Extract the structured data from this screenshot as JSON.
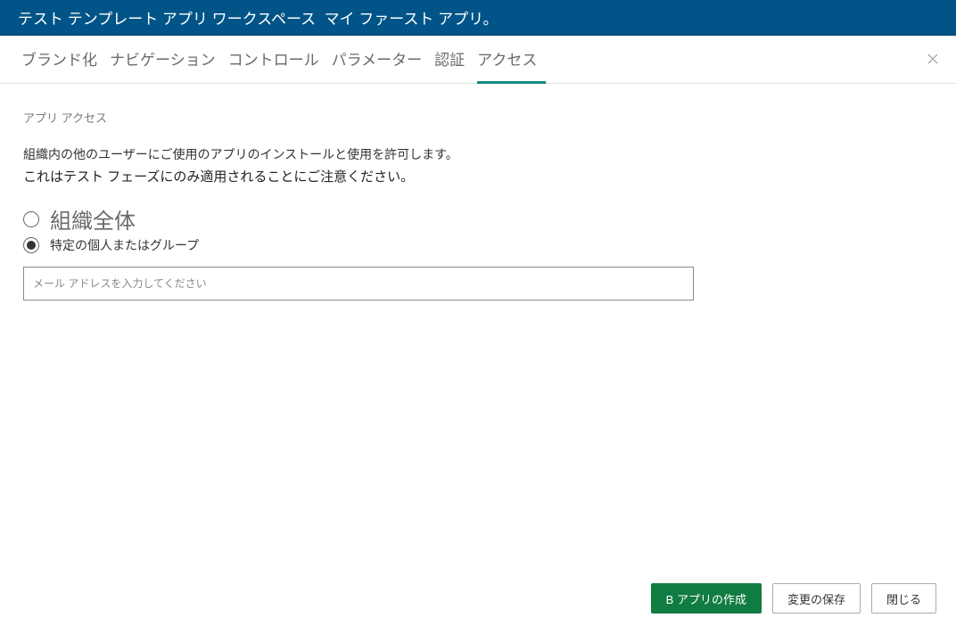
{
  "header": {
    "prefix": "テスト テンプレート アプリ ワークスペース",
    "title": "マイ ファースト アプリ。"
  },
  "tabs": [
    {
      "label": "ブランド化",
      "active": false
    },
    {
      "label": "ナビゲーション",
      "active": false
    },
    {
      "label": "コントロール",
      "active": false
    },
    {
      "label": "パラメーター",
      "active": false
    },
    {
      "label": "認証",
      "active": false
    },
    {
      "label": "アクセス",
      "active": true
    }
  ],
  "access": {
    "section_title": "アプリ アクセス",
    "description_line1": "組織内の他のユーザーにご使用のアプリのインストールと使用を許可します。",
    "description_line2": "これはテスト フェーズにのみ適用されることにご注意ください。",
    "radio_entire_org": "組織全体",
    "radio_specific": "特定の個人またはグループ",
    "email_placeholder": "メール アドレスを入力してください"
  },
  "footer": {
    "create_button": "B アプリの作成",
    "save_button": "変更の保存",
    "close_button": "閉じる"
  }
}
